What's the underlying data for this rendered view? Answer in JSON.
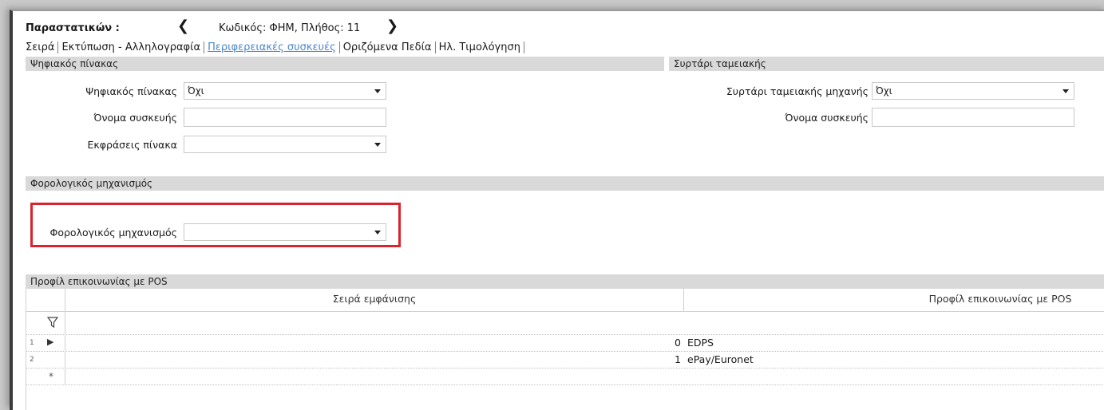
{
  "header": {
    "title": "Παραστατικών :",
    "record_info": "Κωδικός: ΦΗΜ, Πλήθος: 11"
  },
  "tabs": [
    {
      "label": "Σειρά"
    },
    {
      "label": "Εκτύπωση - Αλληλογραφία"
    },
    {
      "label": "Περιφερειακές συσκευές"
    },
    {
      "label": "Οριζόμενα Πεδία"
    },
    {
      "label": "Ηλ. Τιμολόγηση"
    }
  ],
  "digital_board": {
    "section_title": "Ψηφιακός πίνακας",
    "board_label": "Ψηφιακός πίνακας",
    "board_value": "Όχι",
    "device_name_label": "Όνομα συσκευής",
    "device_name_value": "",
    "expressions_label": "Εκφράσεις πίνακα",
    "expressions_value": ""
  },
  "cash_drawer": {
    "section_title": "Συρτάρι ταμειακής",
    "drawer_label": "Συρτάρι ταμειακής μηχανής",
    "drawer_value": "Όχι",
    "device_name_label": "Όνομα συσκευής",
    "device_name_value": ""
  },
  "fiscal": {
    "section_title": "Φορολογικός μηχανισμός",
    "label": "Φορολογικός μηχανισμός",
    "value": ""
  },
  "pos": {
    "section_title": "Προφίλ επικοινωνίας με POS",
    "columns": [
      "Σειρά εμφάνισης",
      "Προφίλ επικοινωνίας με POS"
    ],
    "rows": [
      {
        "num": "1",
        "order": "0",
        "profile": "EDPS"
      },
      {
        "num": "2",
        "order": "1",
        "profile": "ePay/Euronet"
      }
    ],
    "new_row_marker": "*",
    "current_row_marker": "▶"
  },
  "colors": {
    "highlight": "#d9232e",
    "active_tab": "#4a86c8",
    "section_bg": "#d9d9d9"
  }
}
